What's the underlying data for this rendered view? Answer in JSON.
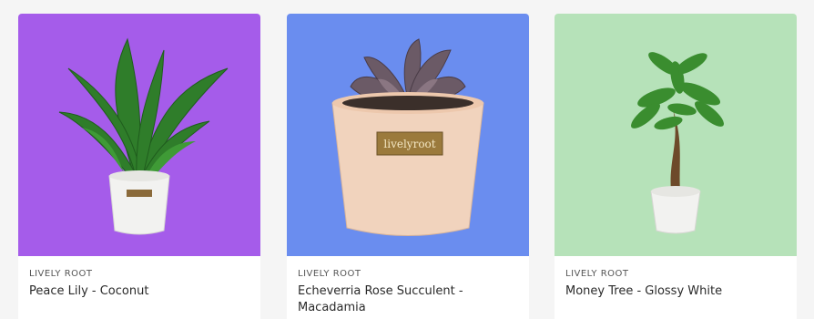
{
  "products": [
    {
      "brand": "LIVELY ROOT",
      "name": "Peace Lily - Coconut",
      "image": {
        "icon": "peace-lily-plant",
        "background": "#a55cea"
      }
    },
    {
      "brand": "LIVELY ROOT",
      "name": "Echeverria Rose Succulent - Macadamia",
      "image": {
        "icon": "echeverria-succulent-plant",
        "background": "#6a8def",
        "pot_label": "livelyroot"
      }
    },
    {
      "brand": "LIVELY ROOT",
      "name": "Money Tree - Glossy White",
      "image": {
        "icon": "money-tree-plant",
        "background": "#b6e2b9"
      }
    }
  ]
}
